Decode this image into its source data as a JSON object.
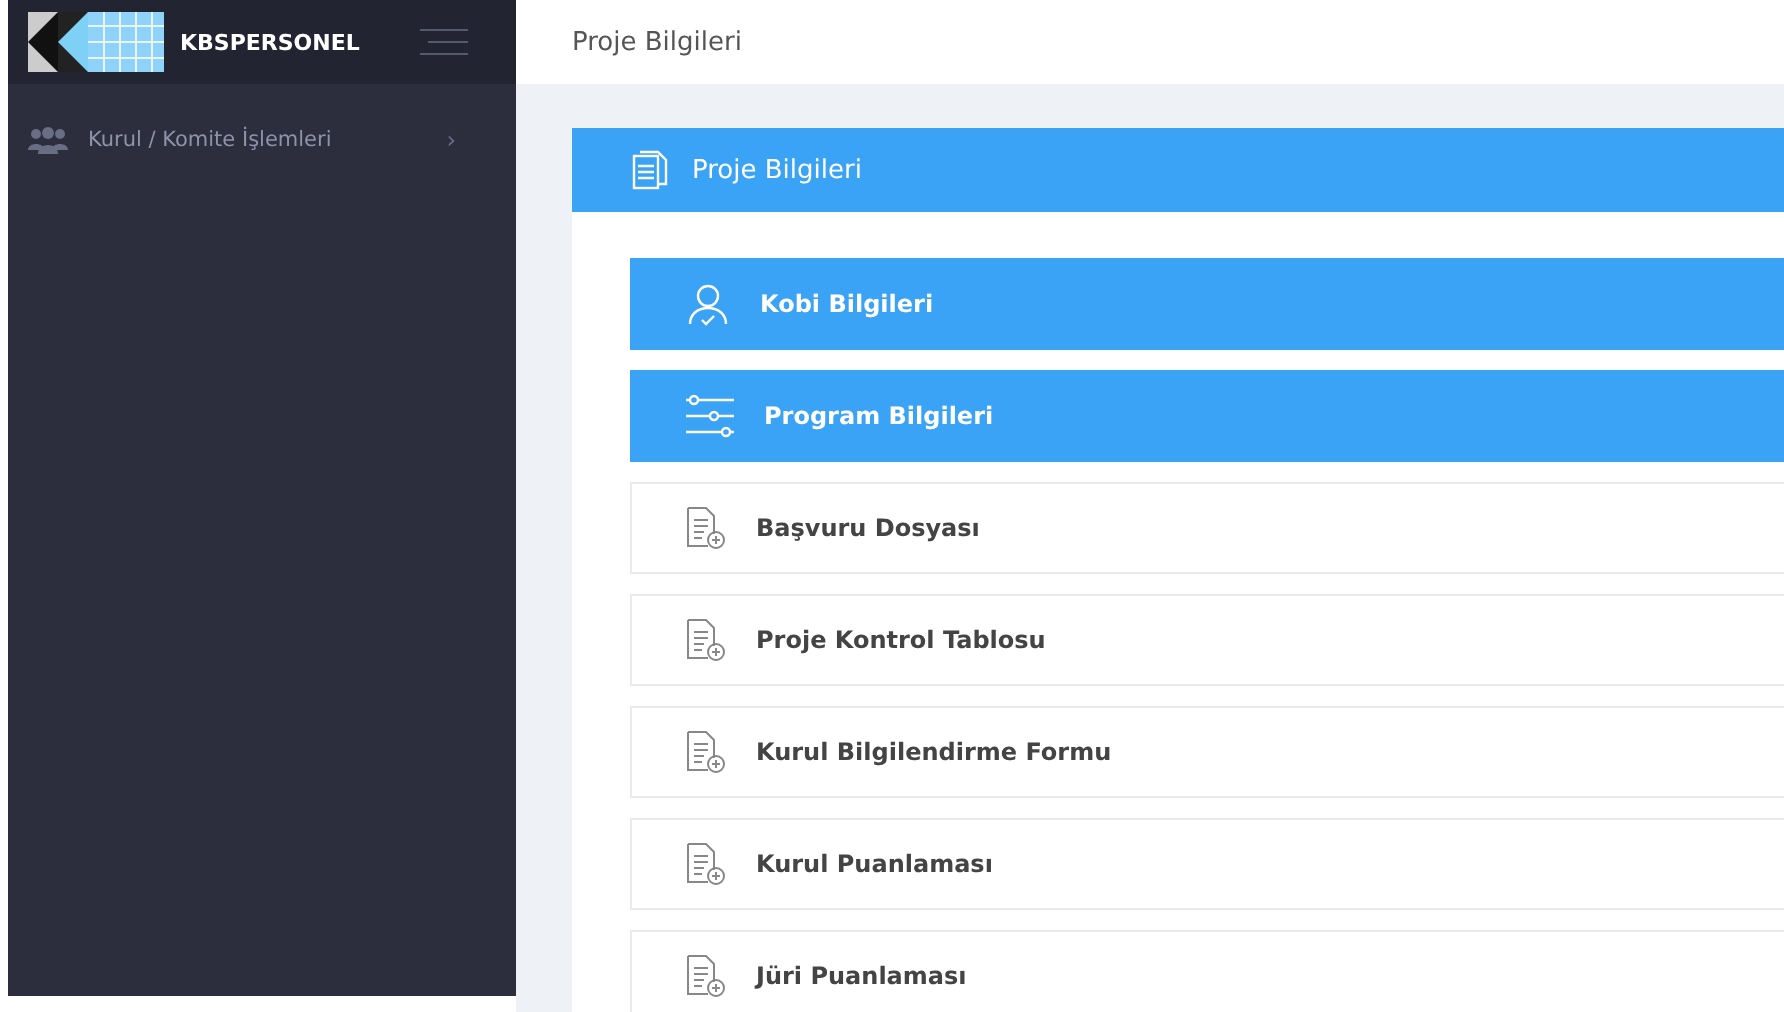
{
  "logo": {
    "text": "KBSPERSONEL"
  },
  "sidebar": {
    "items": [
      {
        "label": "Kurul / Komite İşlemleri",
        "chevron": "›"
      }
    ]
  },
  "header": {
    "title": "Proje Bilgileri"
  },
  "panel": {
    "title": "Proje Bilgileri",
    "items": [
      {
        "label": "Kobi Bilgileri",
        "kind": "user",
        "highlighted": true
      },
      {
        "label": "Program Bilgileri",
        "kind": "sliders",
        "highlighted": true
      },
      {
        "label": "Başvuru Dosyası",
        "kind": "document",
        "highlighted": false
      },
      {
        "label": "Proje Kontrol Tablosu",
        "kind": "document",
        "highlighted": false
      },
      {
        "label": "Kurul Bilgilendirme Formu",
        "kind": "document",
        "highlighted": false
      },
      {
        "label": "Kurul Puanlaması",
        "kind": "document",
        "highlighted": false
      },
      {
        "label": "Jüri Puanlaması",
        "kind": "document",
        "highlighted": false
      }
    ]
  }
}
